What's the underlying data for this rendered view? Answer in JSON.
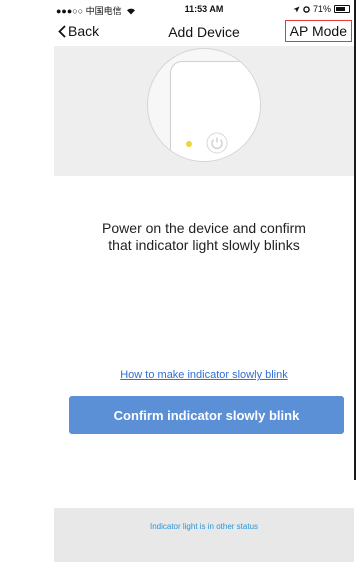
{
  "status_bar": {
    "carrier": "●●●○○ 中国电信",
    "time": "11:53 AM",
    "battery": "71%"
  },
  "nav": {
    "back_label": "Back",
    "title": "Add Device",
    "ap_mode_label": "AP Mode"
  },
  "instruction": {
    "line1": "Power on the device and confirm",
    "line2": "that indicator light slowly blinks"
  },
  "help_link": "How to make indicator slowly blink",
  "confirm_button": "Confirm indicator slowly blink",
  "other_status_link": "Indicator light is in other status",
  "colors": {
    "accent_button": "#5b8fd6",
    "link_blue": "#2f6fd6",
    "status_link": "#2b95d6",
    "led_yellow": "#f2d23a",
    "highlight_border": "#e53935"
  }
}
